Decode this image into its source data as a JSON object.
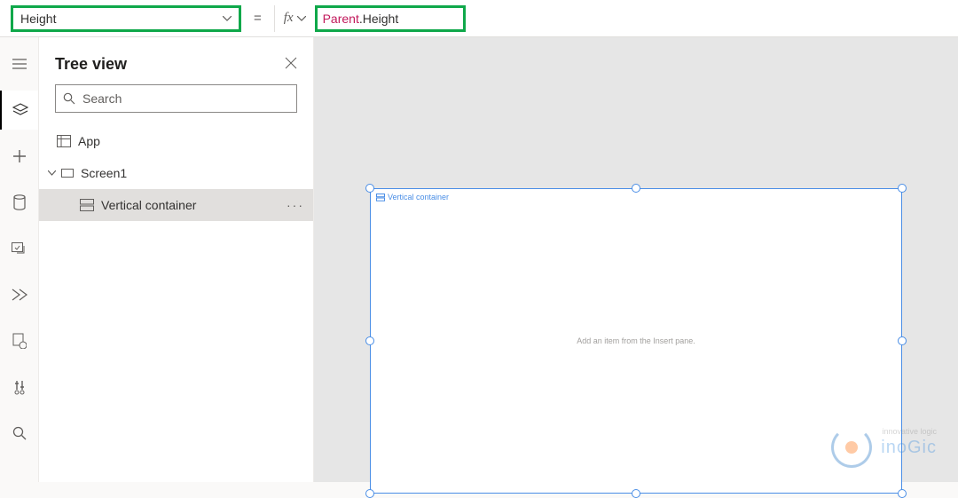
{
  "formula": {
    "property": "Height",
    "equals": "=",
    "fx_label": "fx",
    "token_parent": "Parent",
    "token_dot": ".",
    "token_member": "Height"
  },
  "tree": {
    "title": "Tree view",
    "search_placeholder": "Search",
    "items": {
      "app": "App",
      "screen": "Screen1",
      "child": "Vertical container"
    }
  },
  "canvas": {
    "selected_label": "Vertical container",
    "hint": "Add an item from the Insert pane."
  },
  "watermark": {
    "subtitle": "innovative logic",
    "brand": "inoGic"
  }
}
